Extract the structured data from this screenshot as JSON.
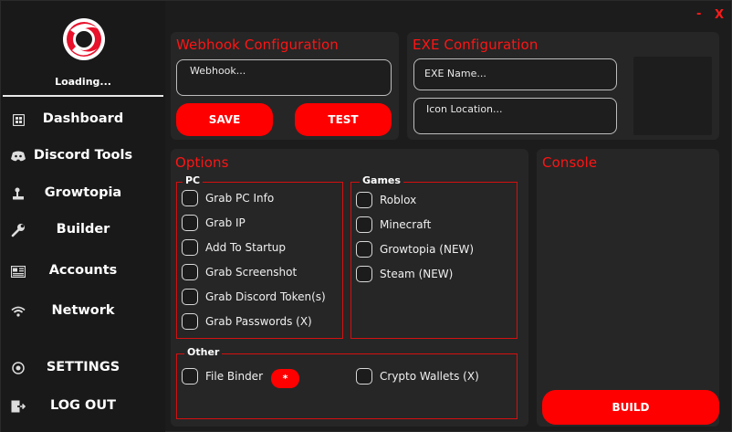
{
  "window": {
    "minimize_label": "-",
    "close_label": "X"
  },
  "colors": {
    "accent": "#ff0000",
    "title": "#ff1414",
    "panel": "#262626",
    "sidebar": "#191919"
  },
  "sidebar": {
    "status": "Loading...",
    "items": [
      {
        "label": "Dashboard",
        "icon": "dashboard-icon"
      },
      {
        "label": "Discord Tools",
        "icon": "discord-icon"
      },
      {
        "label": "Growtopia",
        "icon": "joystick-icon"
      },
      {
        "label": "Builder",
        "icon": "wrench-icon"
      },
      {
        "label": "Accounts",
        "icon": "accounts-icon"
      },
      {
        "label": "Network",
        "icon": "wifi-icon"
      },
      {
        "label": "SETTINGS",
        "icon": "settings-icon"
      },
      {
        "label": "LOG OUT",
        "icon": "logout-icon"
      }
    ]
  },
  "webhook": {
    "title": "Webhook Configuration",
    "placeholder": "Webhook...",
    "save_label": "SAVE",
    "test_label": "TEST"
  },
  "exe": {
    "title": "EXE Configuration",
    "name_placeholder": "EXE Name...",
    "icon_placeholder": "Icon Location..."
  },
  "options": {
    "title": "Options",
    "pc": {
      "label": "PC",
      "items": [
        "Grab PC Info",
        "Grab IP",
        "Add To Startup",
        "Grab Screenshot",
        "Grab Discord Token(s)",
        "Grab Passwords (X)"
      ]
    },
    "games": {
      "label": "Games",
      "items": [
        "Roblox",
        "Minecraft",
        "Growtopia (NEW)",
        "Steam (NEW)"
      ]
    },
    "other": {
      "label": "Other",
      "file_binder": "File Binder",
      "file_binder_button": "*",
      "crypto": "Crypto Wallets (X)"
    }
  },
  "console": {
    "title": "Console",
    "build_label": "BUILD"
  }
}
